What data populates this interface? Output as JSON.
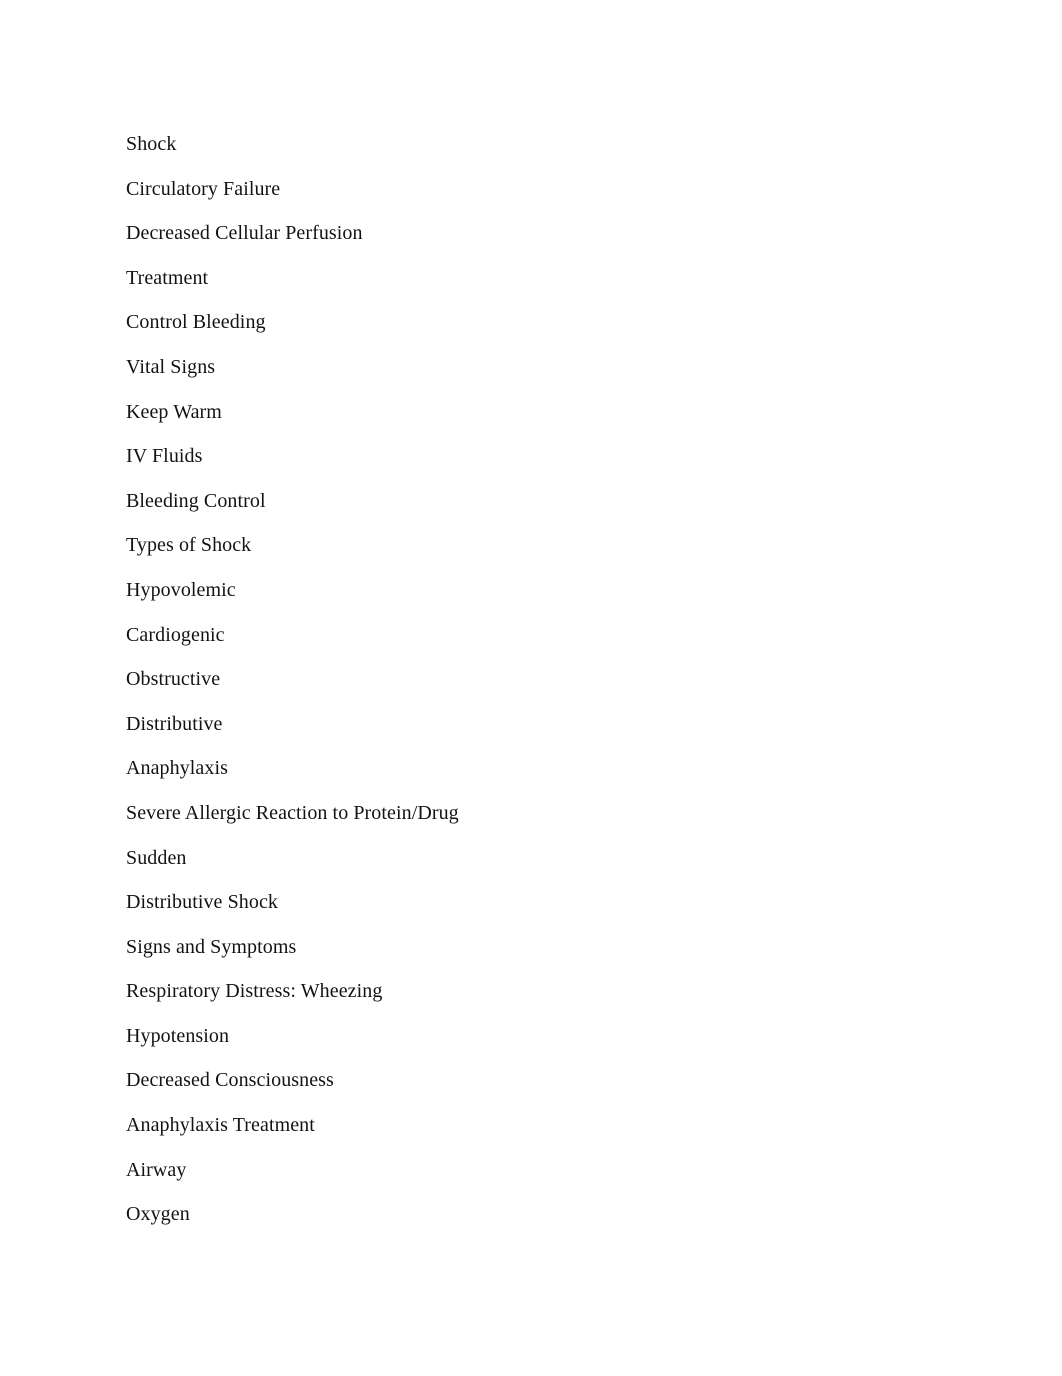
{
  "document": {
    "background_color": "#ffffff",
    "text_color": "#131313",
    "lines": [
      {
        "text": "Shock"
      },
      {
        "text": "Circulatory Failure"
      },
      {
        "text": "Decreased Cellular Perfusion"
      },
      {
        "text": "Treatment"
      },
      {
        "text": "Control Bleeding"
      },
      {
        "text": "Vital Signs"
      },
      {
        "text": "Keep Warm"
      },
      {
        "text": "IV Fluids"
      },
      {
        "text": "Bleeding Control"
      },
      {
        "text": "Types of Shock"
      },
      {
        "text": "Hypovolemic"
      },
      {
        "text": "Cardiogenic"
      },
      {
        "text": "Obstructive"
      },
      {
        "text": "Distributive"
      },
      {
        "text": "Anaphylaxis"
      },
      {
        "text": "Severe Allergic Reaction to Protein/Drug"
      },
      {
        "text": "Sudden"
      },
      {
        "text": "Distributive Shock"
      },
      {
        "text": "Signs and Symptoms"
      },
      {
        "text": "Respiratory Distress: Wheezing"
      },
      {
        "text": "Hypotension"
      },
      {
        "text": "Decreased Consciousness"
      },
      {
        "text": "Anaphylaxis Treatment"
      },
      {
        "text": "Airway"
      },
      {
        "text": "Oxygen"
      }
    ]
  }
}
